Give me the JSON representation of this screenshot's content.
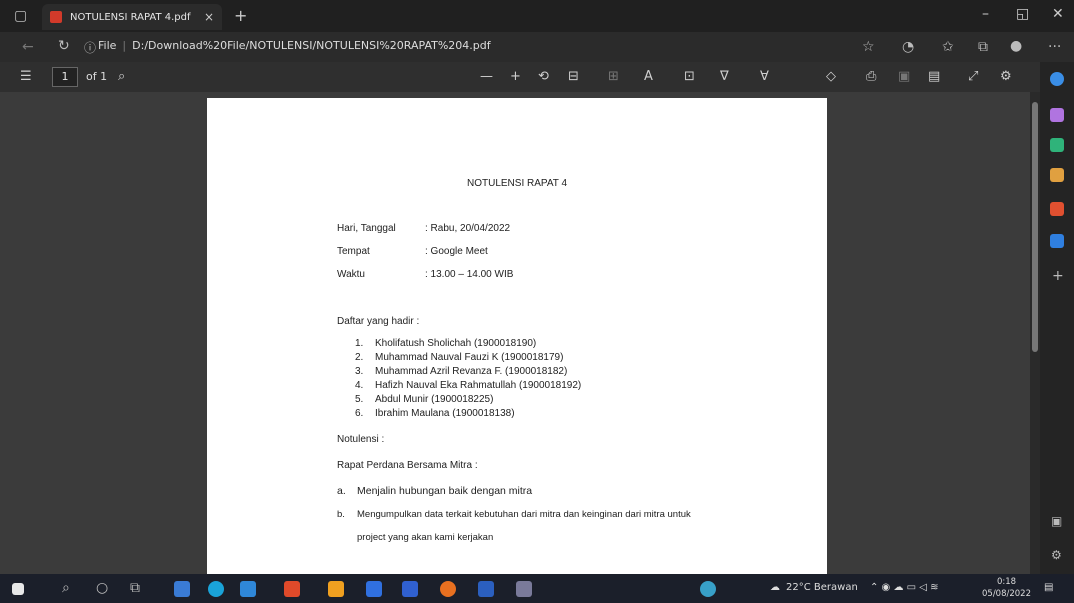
{
  "tab": {
    "title": "NOTULENSI RAPAT 4.pdf",
    "close": "×",
    "new_tab": "+"
  },
  "window": {
    "minimize": "–",
    "restore": "◱",
    "close": "✕"
  },
  "address": {
    "scheme": "File",
    "url": "D:/Download%20File/NOTULENSI/NOTULENSI%20RAPAT%204.pdf"
  },
  "pdf_toolbar": {
    "page": "1",
    "of_pages": "of 1",
    "zoom_out": "—",
    "zoom_in": "+"
  },
  "document": {
    "title": "NOTULENSI RAPAT 4",
    "info": [
      {
        "label": "Hari, Tanggal",
        "value": ": Rabu, 20/04/2022"
      },
      {
        "label": "Tempat",
        "value": ": Google Meet"
      },
      {
        "label": "Waktu",
        "value": ": 13.00 – 14.00 WIB"
      }
    ],
    "attendance_heading": "Daftar yang hadir :",
    "attendees": [
      {
        "num": "1.",
        "text": "Kholifatush Sholichah (1900018190)"
      },
      {
        "num": "2.",
        "text": "Muhammad Nauval Fauzi K (1900018179)"
      },
      {
        "num": "3.",
        "text": "Muhammad Azril Revanza F. (1900018182)"
      },
      {
        "num": "4.",
        "text": "Hafizh Nauval Eka Rahmatullah (1900018192)"
      },
      {
        "num": "5.",
        "text": "Abdul Munir (1900018225)"
      },
      {
        "num": "6.",
        "text": "Ibrahim Maulana (1900018138)"
      }
    ],
    "notulensi_label": "Notulensi :",
    "meeting_label": "Rapat Perdana Bersama Mitra :",
    "points": [
      {
        "letter": "a.",
        "text": "Menjalin hubungan baik dengan mitra"
      },
      {
        "letter": "b.",
        "text": "Mengumpulkan data terkait kebutuhan dari mitra dan keinginan dari mitra untuk"
      }
    ],
    "point_b_continued": "project yang akan kami kerjakan"
  },
  "taskbar": {
    "weather": "22°C Berawan",
    "time": "0:18",
    "date": "05/08/2022"
  },
  "colors": {
    "accent": "#d23a2a",
    "page_bg": "#ffffff",
    "viewer_bg": "#3b3b3b"
  }
}
